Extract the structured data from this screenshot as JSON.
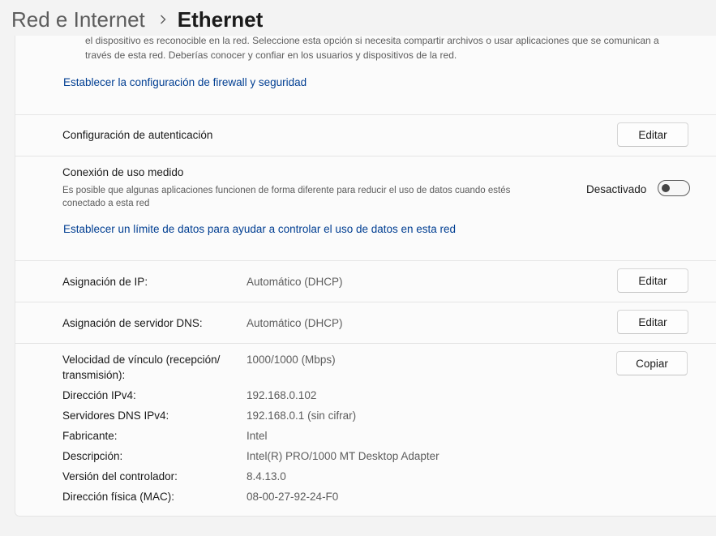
{
  "breadcrumb": {
    "parent": "Red e Internet",
    "current": "Ethernet"
  },
  "firewall": {
    "cut_line": "el dispositivo es reconocible en la red. Seleccione esta opción si necesita compartir archivos o usar aplicaciones que se comunican a",
    "description_line": "través de esta red. Deberías conocer y confiar en los usuarios y dispositivos de la red.",
    "link": "Establecer la configuración de firewall y seguridad"
  },
  "authentication": {
    "label": "Configuración de autenticación",
    "button": "Editar"
  },
  "metered": {
    "title": "Conexión de uso medido",
    "description": "Es posible que algunas aplicaciones funcionen de forma diferente para reducir el uso de datos cuando estés conectado a esta red",
    "state": "Desactivado",
    "toggle_on": false,
    "link": "Establecer un límite de datos para ayudar a controlar el uso de datos en esta red"
  },
  "ip": {
    "label": "Asignación de IP:",
    "value": "Automático (DHCP)",
    "button": "Editar"
  },
  "dns": {
    "label": "Asignación de servidor DNS:",
    "value": "Automático (DHCP)",
    "button": "Editar"
  },
  "properties": {
    "copy_button": "Copiar",
    "items": [
      {
        "label": "Velocidad de vínculo (recepción/\ntransmisión):",
        "value": "1000/1000 (Mbps)"
      },
      {
        "label": "Dirección IPv4:",
        "value": "192.168.0.102"
      },
      {
        "label": "Servidores DNS IPv4:",
        "value": "192.168.0.1 (sin cifrar)"
      },
      {
        "label": "Fabricante:",
        "value": "Intel"
      },
      {
        "label": "Descripción:",
        "value": "Intel(R) PRO/1000 MT Desktop Adapter"
      },
      {
        "label": "Versión del controlador:",
        "value": "8.4.13.0"
      },
      {
        "label": "Dirección física (MAC):",
        "value": "08-00-27-92-24-F0"
      }
    ]
  },
  "colors": {
    "link": "#003e92",
    "background": "#f3f3f3",
    "card": "#fbfbfb"
  }
}
